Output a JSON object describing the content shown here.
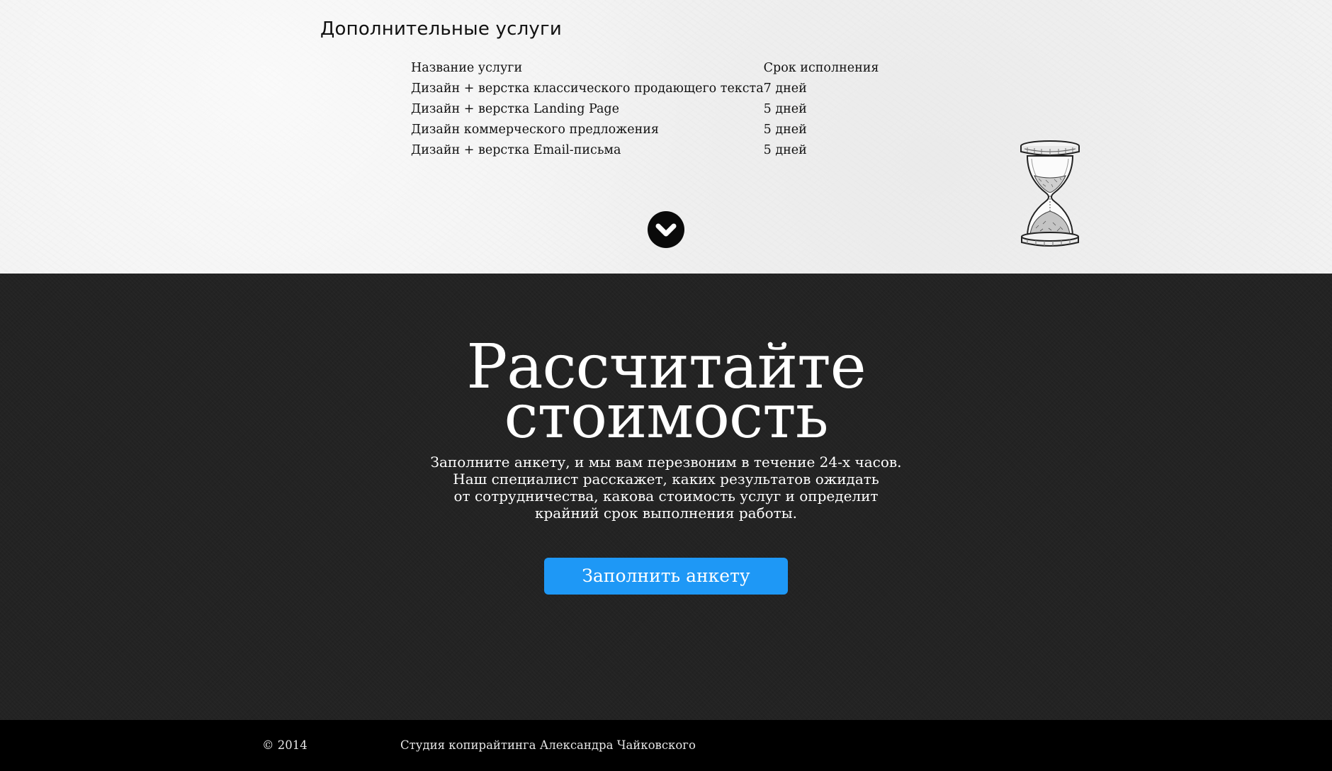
{
  "services": {
    "title": "Дополнительные услуги",
    "columns": [
      "Название услуги",
      "Срок исполнения"
    ],
    "rows": [
      {
        "name": "Дизайн + верстка классического продающего текста",
        "term": "7 дней"
      },
      {
        "name": "Дизайн + верстка Landing Page",
        "term": "5 дней"
      },
      {
        "name": "Дизайн коммерческого предложения",
        "term": "5 дней"
      },
      {
        "name": "Дизайн + верстка Email-письма",
        "term": "5 дней"
      }
    ],
    "scroll_icon": "chevron-down-circle-icon",
    "decor_icon": "hourglass-icon"
  },
  "cta": {
    "heading_line1": "Рассчитайте",
    "heading_line2": "стоимость",
    "text_lines": [
      "Заполните анкету, и мы вам перезвоним в течение 24-х часов.",
      "Наш специалист расскажет, каких результатов ожидать",
      "от сотрудничества, какова стоимость услуг и определит",
      "крайний срок выполнения работы."
    ],
    "button_label": "Заполнить анкету"
  },
  "footer": {
    "copyright": "© 2014",
    "studio": "Студия копирайтинга Александра Чайковского"
  },
  "colors": {
    "light_bg": "#f2f2f2",
    "dark_bg": "#232323",
    "footer_bg": "#000000",
    "accent": "#1e98f6"
  }
}
